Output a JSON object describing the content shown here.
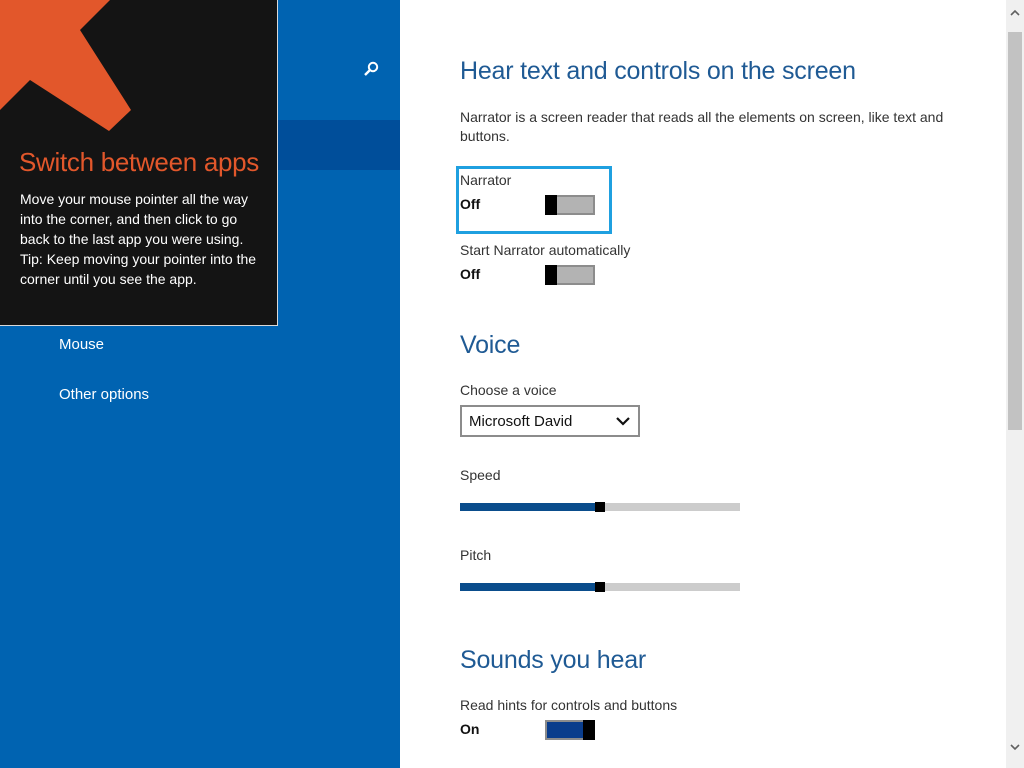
{
  "sidebar": {
    "search_icon": "magnifier-icon",
    "nav_items": [
      {
        "label": "Mouse"
      },
      {
        "label": "Other options"
      }
    ]
  },
  "tip": {
    "title": "Switch between apps",
    "body": "Move your mouse pointer all the way into the corner, and then click to go back to the last app you were using.",
    "tip": "Tip: Keep moving your pointer into the corner until you see the app.",
    "accent_color": "#e2572b"
  },
  "main": {
    "section_hear": {
      "title": "Hear text and controls on the screen",
      "description": "Narrator is a screen reader that reads all the elements on screen, like text and buttons."
    },
    "narrator": {
      "label": "Narrator",
      "state": "Off"
    },
    "start_auto": {
      "label": "Start Narrator automatically",
      "state": "Off"
    },
    "section_voice": {
      "title": "Voice"
    },
    "voice": {
      "label": "Choose a voice",
      "selected": "Microsoft David"
    },
    "speed": {
      "label": "Speed",
      "value_percent": 50
    },
    "pitch": {
      "label": "Pitch",
      "value_percent": 50
    },
    "section_sounds": {
      "title": "Sounds you hear"
    },
    "read_hints": {
      "label": "Read hints for controls and buttons",
      "state": "On"
    }
  },
  "colors": {
    "sidebar_bg": "#0063b1",
    "heading": "#1f5a94",
    "focus": "#1fa0e0",
    "slider_fill": "#0a4d8c"
  }
}
